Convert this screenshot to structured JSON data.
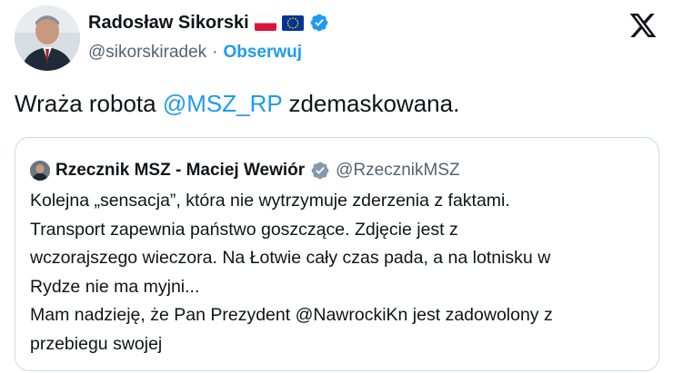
{
  "post": {
    "author": {
      "display_name": "Radosław Sikorski",
      "handle": "@sikorskiradek",
      "separator": "·",
      "follow_label": "Obserwuj",
      "flags": [
        "poland-flag-icon",
        "eu-flag-icon"
      ],
      "verified_icon": "verified-badge-icon"
    },
    "platform_icon": "x-logo-icon",
    "text": {
      "before": "Wraża robota ",
      "mention": "@MSZ_RP",
      "after": " zdemaskowana."
    },
    "quote": {
      "display_name": "Rzecznik MSZ - Maciej Wewiór",
      "handle": "@RzecznikMSZ",
      "verified_icon": "gray-verified-badge-icon",
      "lines": [
        "Kolejna „sensacja”, która nie wytrzymuje zderzenia z faktami.",
        "Transport zapewnia państwo goszczące. Zdjęcie jest z",
        "wczorajszego wieczora. Na Łotwie cały czas pada, a na lotnisku w",
        "Rydze nie ma myjni...",
        "Mam nadzieję, że Pan Prezydent @NawrockiKn jest zadowolony z",
        "przebiegu swojej"
      ]
    }
  },
  "colors": {
    "link": "#1d9bf0",
    "secondary_text": "#536471",
    "primary_text": "#0f1419",
    "border": "#cfd9de"
  }
}
